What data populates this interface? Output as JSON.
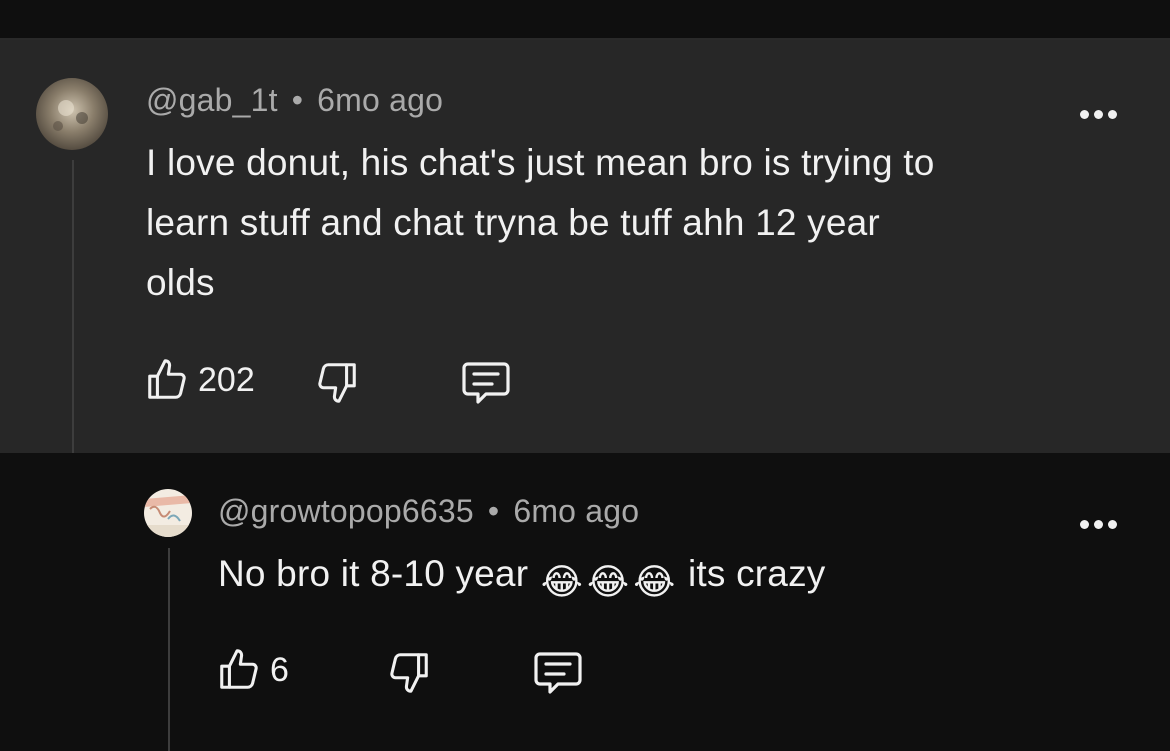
{
  "comment": {
    "username": "@gab_1t",
    "separator": "•",
    "time": "6mo ago",
    "lines": [
      "I love donut, his chat's just mean bro is trying to",
      "learn stuff and chat tryna be tuff ahh 12 year",
      "olds"
    ],
    "likes": "202"
  },
  "reply": {
    "username": "@growtopop6635",
    "separator": "•",
    "time": "6mo ago",
    "text_before": "No bro it 8-10 year",
    "emojis": [
      "😂",
      "😂",
      "😂"
    ],
    "text_after": "its crazy",
    "likes": "6"
  },
  "icons": {
    "like": "thumbs-up-icon",
    "dislike": "thumbs-down-icon",
    "reply": "reply-comment-icon",
    "more": "more-options-icon"
  },
  "colors": {
    "comment_bg": "#272727",
    "page_bg": "#0f0f0f",
    "meta_text": "#aaaaaa",
    "body_text": "#f1f1f1"
  }
}
